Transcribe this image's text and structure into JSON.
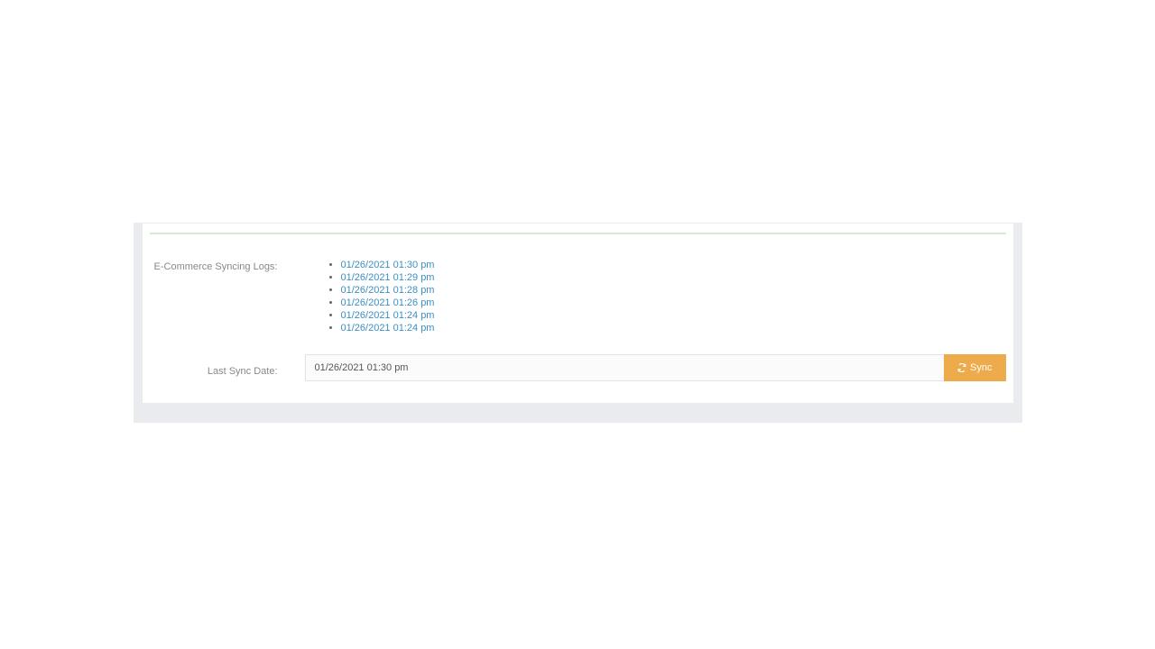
{
  "labels": {
    "syncing_logs": "E-Commerce Syncing Logs:",
    "last_sync_date": "Last Sync Date:"
  },
  "logs": [
    "01/26/2021 01:30 pm",
    "01/26/2021 01:29 pm",
    "01/26/2021 01:28 pm",
    "01/26/2021 01:26 pm",
    "01/26/2021 01:24 pm",
    "01/26/2021 01:24 pm"
  ],
  "last_sync": {
    "value": "01/26/2021 01:30 pm"
  },
  "buttons": {
    "sync": "Sync"
  }
}
